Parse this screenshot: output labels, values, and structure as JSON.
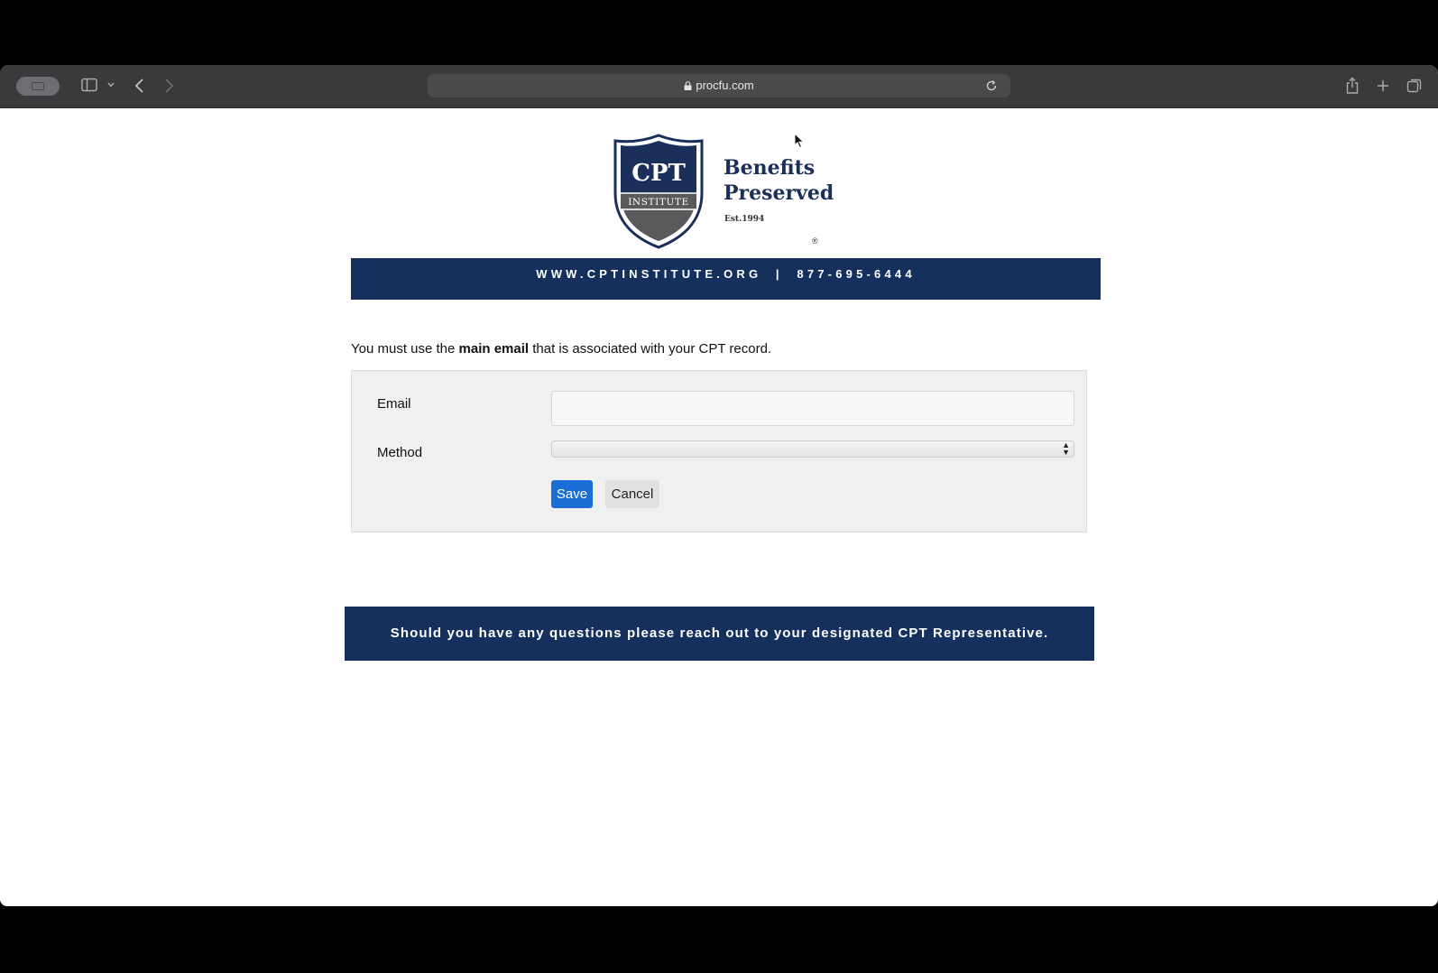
{
  "browser": {
    "url": "procfu.com"
  },
  "logo": {
    "shield_top": "CPT",
    "shield_band": "INSTITUTE",
    "line1": "Benefits",
    "line2": "Preserved",
    "est": "Est.1994",
    "reg_mark": "®"
  },
  "header_banner": {
    "text": "WWW.CPTINSTITUTE.ORG  |  877-695-6444"
  },
  "notice": {
    "prefix": "You must use the ",
    "bold": "main email",
    "suffix": " that is associated with your CPT record."
  },
  "form": {
    "email_label": "Email",
    "email_value": "",
    "method_label": "Method",
    "method_value": "",
    "save_label": "Save",
    "cancel_label": "Cancel"
  },
  "footer_banner": {
    "text": "Should you have any questions please reach out to your designated CPT Representative."
  },
  "colors": {
    "brand_navy": "#15305c",
    "primary_button": "#1b6ed6"
  }
}
